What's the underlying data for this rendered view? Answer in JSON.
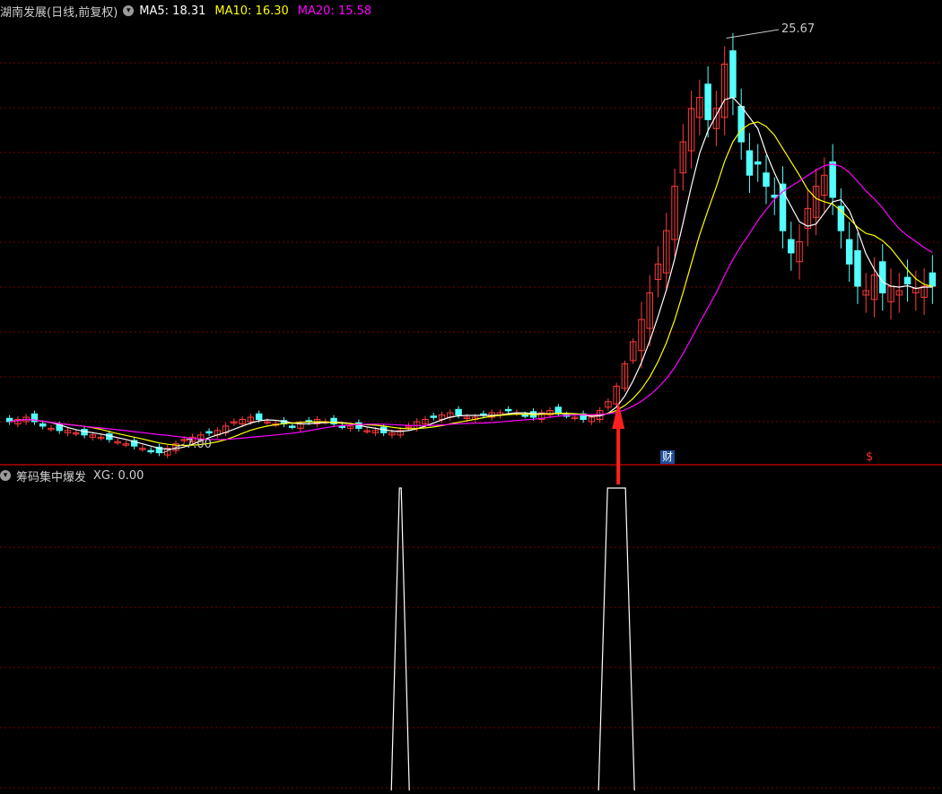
{
  "main_panel": {
    "title": "湖南发展(日线,前复权)",
    "ma5_label": "MA5: 18.31",
    "ma10_label": "MA10: 16.30",
    "ma20_label": "MA20: 15.58",
    "high_annotation": "25.67",
    "low_annotation": "7.00",
    "badge_finance": "财",
    "badge_dollar": "$",
    "colors": {
      "up": "#ff3b3b",
      "down": "#54ffff",
      "ma5": "#ffffff",
      "ma10": "#ffff00",
      "ma20": "#ff00ff",
      "grid": "#7a0000",
      "arrow": "#ff2020"
    }
  },
  "sub_panel": {
    "title": "筹码集中爆发",
    "xg_label": "XG: 0.00"
  },
  "icons": {
    "settings": "gear-icon"
  },
  "chart_data": {
    "type": "candlestick",
    "price_range": [
      6.5,
      26.5
    ],
    "high": 25.67,
    "low": 7.0,
    "ma_last": {
      "MA5": 18.31,
      "MA10": 16.3,
      "MA20": 15.58
    },
    "closes": [
      8.4,
      8.5,
      8.6,
      8.4,
      8.2,
      8.1,
      8.0,
      8.0,
      7.9,
      7.8,
      7.8,
      7.7,
      7.6,
      7.5,
      7.4,
      7.3,
      7.2,
      7.1,
      7.0,
      7.2,
      7.4,
      7.6,
      7.7,
      7.8,
      7.9,
      8.0,
      8.2,
      8.4,
      8.5,
      8.6,
      8.5,
      8.4,
      8.3,
      8.3,
      8.2,
      8.3,
      8.4,
      8.5,
      8.4,
      8.3,
      8.2,
      8.2,
      8.1,
      8.0,
      8.0,
      7.9,
      7.9,
      8.0,
      8.2,
      8.4,
      8.5,
      8.6,
      8.7,
      8.8,
      8.7,
      8.6,
      8.6,
      8.7,
      8.8,
      8.8,
      8.9,
      8.8,
      8.7,
      8.6,
      8.8,
      8.9,
      8.8,
      8.7,
      8.6,
      8.5,
      8.6,
      8.9,
      9.3,
      10.0,
      11.0,
      12.0,
      13.0,
      14.2,
      15.5,
      17.0,
      19.0,
      21.0,
      22.5,
      23.0,
      22.0,
      22.5,
      24.5,
      23.0,
      21.0,
      19.5,
      20.0,
      19.0,
      18.5,
      17.0,
      16.0,
      16.5,
      18.0,
      19.0,
      19.5,
      18.5,
      17.0,
      15.5,
      14.5,
      14.3,
      15.0,
      14.2,
      14.5,
      14.3,
      14.6,
      14.4,
      14.5,
      14.5
    ],
    "xg_signal_indices": [
      47,
      73
    ]
  }
}
